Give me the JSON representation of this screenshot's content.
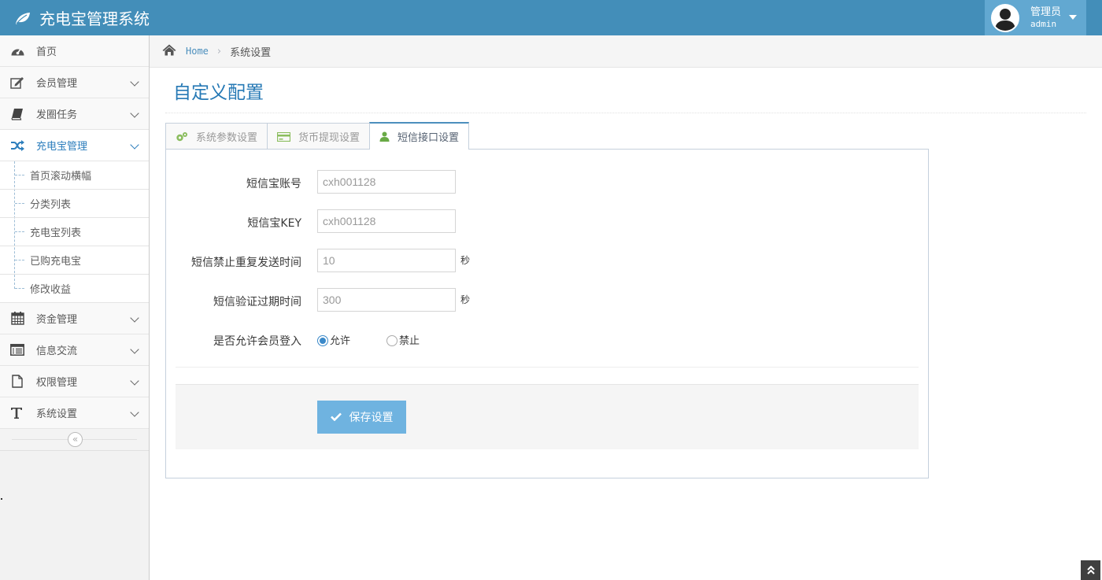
{
  "app": {
    "title": "充电宝管理系统"
  },
  "user": {
    "role": "管理员",
    "name": "admin"
  },
  "sidebar": {
    "items": [
      {
        "label": "首页",
        "icon": "dashboard-icon"
      },
      {
        "label": "会员管理",
        "icon": "edit-icon"
      },
      {
        "label": "发圈任务",
        "icon": "book-icon"
      },
      {
        "label": "充电宝管理",
        "icon": "random-icon",
        "active": true,
        "subitems": [
          "首页滚动横幅",
          "分类列表",
          "充电宝列表",
          "已购充电宝",
          "修改收益"
        ]
      },
      {
        "label": "资金管理",
        "icon": "calendar-icon"
      },
      {
        "label": "信息交流",
        "icon": "list-alt-icon"
      },
      {
        "label": "权限管理",
        "icon": "file-icon"
      },
      {
        "label": "系统设置",
        "icon": "text-width-icon"
      }
    ]
  },
  "breadcrumb": {
    "home": "Home",
    "current": "系统设置"
  },
  "page": {
    "title": "自定义配置"
  },
  "tabs": [
    {
      "label": "系统参数设置",
      "icon": "cogs-icon"
    },
    {
      "label": "货币提现设置",
      "icon": "credit-card-icon"
    },
    {
      "label": "短信接口设置",
      "icon": "user-icon",
      "active": true
    }
  ],
  "form": {
    "account": {
      "label": "短信宝账号",
      "value": "cxh001128"
    },
    "key": {
      "label": "短信宝KEY",
      "value": "cxh001128"
    },
    "resend": {
      "label": "短信禁止重复发送时间",
      "value": "10",
      "unit": "秒"
    },
    "expire": {
      "label": "短信验证过期时间",
      "value": "300",
      "unit": "秒"
    },
    "login": {
      "label": "是否允许会员登入",
      "options": [
        "允许",
        "禁止"
      ],
      "selected": "允许"
    },
    "save_label": "保存设置"
  },
  "colors": {
    "navbar": "#438eb9",
    "accent": "#2679b5",
    "save_button": "#6fb3e0"
  }
}
